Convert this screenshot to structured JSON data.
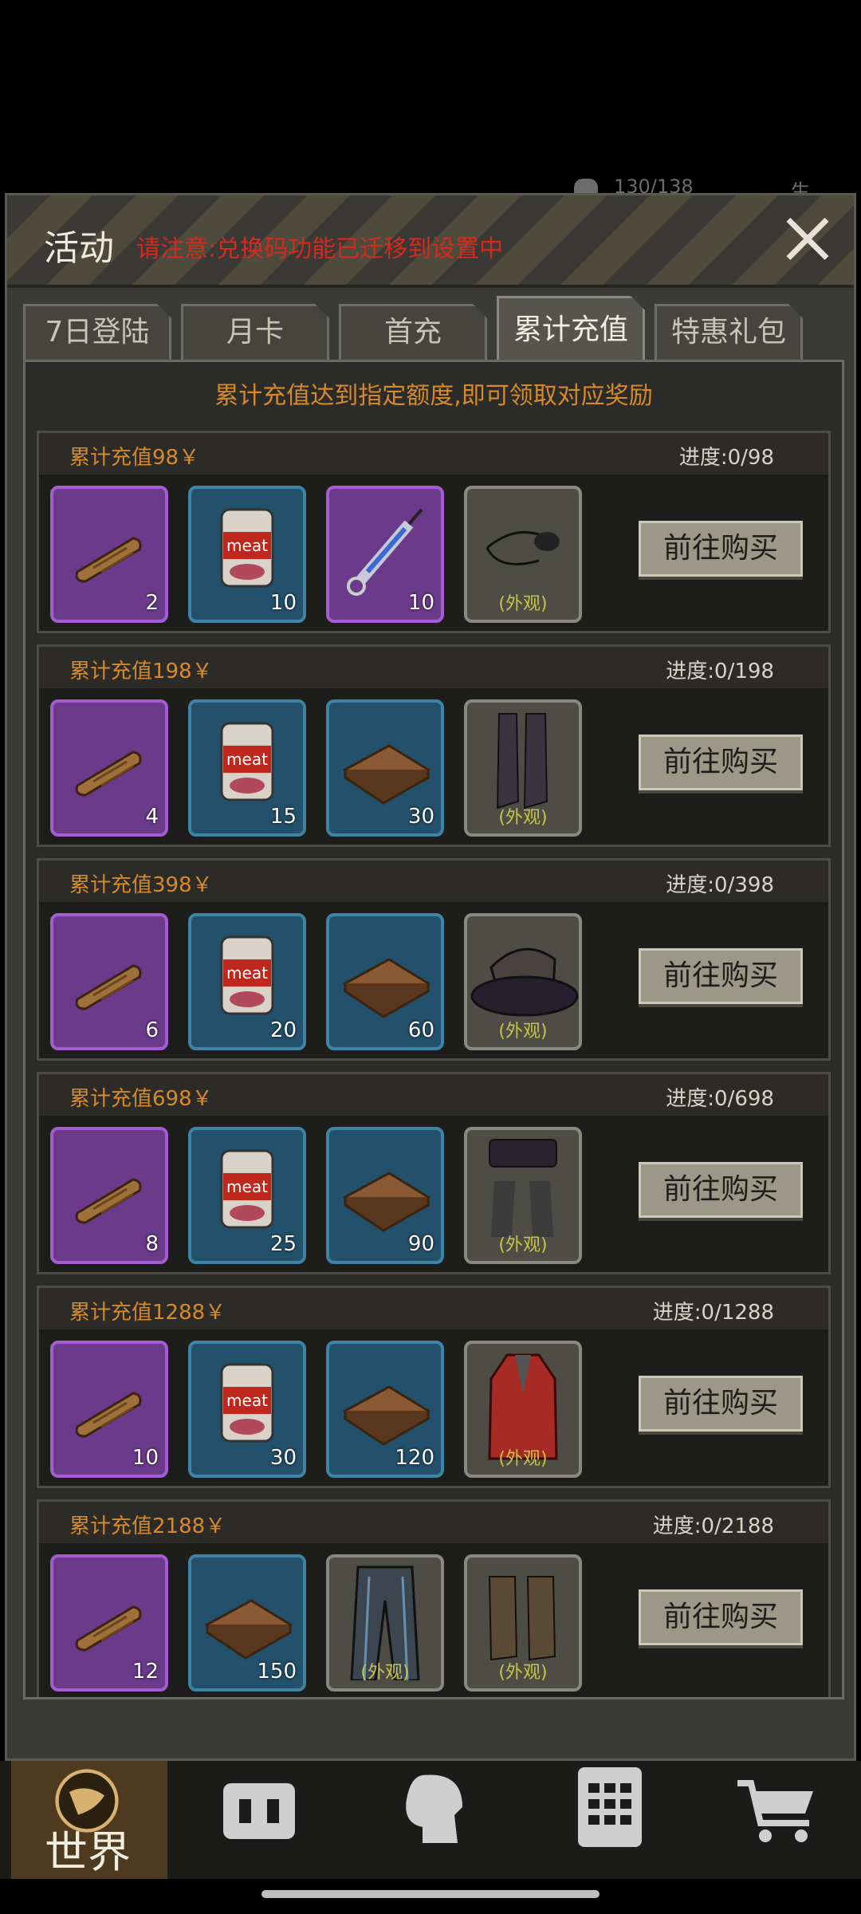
{
  "status": {
    "hp": "130/138",
    "life_label": "生命"
  },
  "header": {
    "title": "活动",
    "notice": "请注意:兑换码功能已迁移到设置中"
  },
  "tabs": [
    {
      "label": "7日登陆"
    },
    {
      "label": "月卡"
    },
    {
      "label": "首充"
    },
    {
      "label": "累计充值"
    },
    {
      "label": "特惠礼包"
    }
  ],
  "banner": "累计充值达到指定额度,即可领取对应奖励",
  "buy_label": "前往购买",
  "skin_label": "(外观)",
  "tiers": [
    {
      "title": "累计充值98￥",
      "progress": "进度:0/98",
      "items": [
        {
          "icon": "cigar-icon",
          "q": "2",
          "rarity": "purple"
        },
        {
          "icon": "meat-can-icon",
          "q": "10",
          "rarity": "blue"
        },
        {
          "icon": "syringe-icon",
          "q": "10",
          "rarity": "purple"
        },
        {
          "icon": "eyepatch-icon",
          "q": "",
          "rarity": "grey",
          "skin": true
        }
      ]
    },
    {
      "title": "累计充值198￥",
      "progress": "进度:0/198",
      "items": [
        {
          "icon": "cigar-icon",
          "q": "4",
          "rarity": "purple"
        },
        {
          "icon": "meat-can-icon",
          "q": "15",
          "rarity": "blue"
        },
        {
          "icon": "book-icon",
          "q": "30",
          "rarity": "blue"
        },
        {
          "icon": "boots-icon",
          "q": "",
          "rarity": "grey",
          "skin": true
        }
      ]
    },
    {
      "title": "累计充值398￥",
      "progress": "进度:0/398",
      "items": [
        {
          "icon": "cigar-icon",
          "q": "6",
          "rarity": "purple"
        },
        {
          "icon": "meat-can-icon",
          "q": "20",
          "rarity": "blue"
        },
        {
          "icon": "book-icon",
          "q": "60",
          "rarity": "blue"
        },
        {
          "icon": "hat-icon",
          "q": "",
          "rarity": "grey",
          "skin": true
        }
      ]
    },
    {
      "title": "累计充值698￥",
      "progress": "进度:0/698",
      "items": [
        {
          "icon": "cigar-icon",
          "q": "8",
          "rarity": "purple"
        },
        {
          "icon": "meat-can-icon",
          "q": "25",
          "rarity": "blue"
        },
        {
          "icon": "book-icon",
          "q": "90",
          "rarity": "blue"
        },
        {
          "icon": "stockings-icon",
          "q": "",
          "rarity": "grey",
          "skin": true
        }
      ]
    },
    {
      "title": "累计充值1288￥",
      "progress": "进度:0/1288",
      "items": [
        {
          "icon": "cigar-icon",
          "q": "10",
          "rarity": "purple"
        },
        {
          "icon": "meat-can-icon",
          "q": "30",
          "rarity": "blue"
        },
        {
          "icon": "book-icon",
          "q": "120",
          "rarity": "blue"
        },
        {
          "icon": "coat-icon",
          "q": "",
          "rarity": "grey",
          "skin": true
        }
      ]
    },
    {
      "title": "累计充值2188￥",
      "progress": "进度:0/2188",
      "items": [
        {
          "icon": "cigar-icon",
          "q": "12",
          "rarity": "purple"
        },
        {
          "icon": "book-icon",
          "q": "150",
          "rarity": "blue"
        },
        {
          "icon": "trousers-icon",
          "q": "",
          "rarity": "grey",
          "skin": true
        },
        {
          "icon": "laced-boots-icon",
          "q": "",
          "rarity": "grey",
          "skin": true
        }
      ]
    }
  ],
  "bottom_nav": [
    {
      "label": "世界",
      "icon": "globe-icon"
    },
    {
      "label": "",
      "icon": "backpack-icon"
    },
    {
      "label": "",
      "icon": "head-icon"
    },
    {
      "label": "",
      "icon": "phone-icon"
    },
    {
      "label": "",
      "icon": "cart-icon"
    }
  ]
}
